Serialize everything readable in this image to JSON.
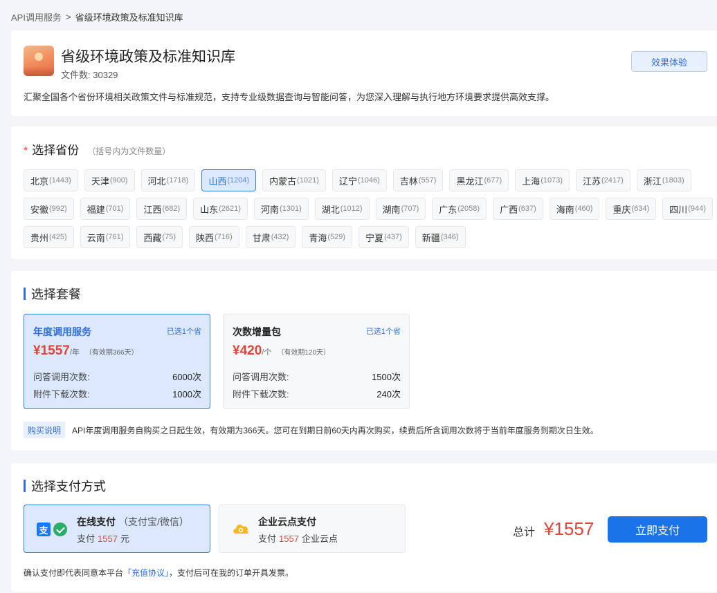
{
  "breadcrumb": {
    "parent": "API调用服务",
    "separator": ">",
    "current": "省级环境政策及标准知识库"
  },
  "header": {
    "title": "省级环境政策及标准知识库",
    "file_count_label": "文件数:",
    "file_count": "30329",
    "experience_button": "效果体验",
    "description": "汇聚全国各个省份环境相关政策文件与标准规范，支持专业级数据查询与智能问答，为您深入理解与执行地方环境要求提供高效支撑。"
  },
  "province": {
    "required_mark": "*",
    "title": "选择省份",
    "hint": "（括号内为文件数量）",
    "items": [
      {
        "name": "北京",
        "count": "(1443)"
      },
      {
        "name": "天津",
        "count": "(900)"
      },
      {
        "name": "河北",
        "count": "(1718)"
      },
      {
        "name": "山西",
        "count": "(1204)",
        "selected": true
      },
      {
        "name": "内蒙古",
        "count": "(1021)"
      },
      {
        "name": "辽宁",
        "count": "(1046)"
      },
      {
        "name": "吉林",
        "count": "(557)"
      },
      {
        "name": "黑龙江",
        "count": "(677)"
      },
      {
        "name": "上海",
        "count": "(1073)"
      },
      {
        "name": "江苏",
        "count": "(2417)"
      },
      {
        "name": "浙江",
        "count": "(1803)"
      },
      {
        "name": "安徽",
        "count": "(992)"
      },
      {
        "name": "福建",
        "count": "(701)"
      },
      {
        "name": "江西",
        "count": "(682)"
      },
      {
        "name": "山东",
        "count": "(2621)"
      },
      {
        "name": "河南",
        "count": "(1301)"
      },
      {
        "name": "湖北",
        "count": "(1012)"
      },
      {
        "name": "湖南",
        "count": "(707)"
      },
      {
        "name": "广东",
        "count": "(2058)"
      },
      {
        "name": "广西",
        "count": "(637)"
      },
      {
        "name": "海南",
        "count": "(460)"
      },
      {
        "name": "重庆",
        "count": "(634)"
      },
      {
        "name": "四川",
        "count": "(944)"
      },
      {
        "name": "贵州",
        "count": "(425)"
      },
      {
        "name": "云南",
        "count": "(761)"
      },
      {
        "name": "西藏",
        "count": "(75)"
      },
      {
        "name": "陕西",
        "count": "(716)"
      },
      {
        "name": "甘肃",
        "count": "(432)"
      },
      {
        "name": "青海",
        "count": "(529)"
      },
      {
        "name": "宁夏",
        "count": "(437)"
      },
      {
        "name": "新疆",
        "count": "(346)"
      }
    ]
  },
  "plan": {
    "title": "选择套餐",
    "annual": {
      "name": "年度调用服务",
      "selected_tag": "已选1个省",
      "price": "¥1557",
      "unit": "/年",
      "validity": "（有效期366天）",
      "qa_label": "问答调用次数:",
      "qa_value": "6000次",
      "dl_label": "附件下载次数:",
      "dl_value": "1000次"
    },
    "pack": {
      "name": "次数增量包",
      "selected_tag": "已选1个省",
      "price": "¥420",
      "unit": "/个",
      "validity": "（有效期120天）",
      "qa_label": "问答调用次数:",
      "qa_value": "1500次",
      "dl_label": "附件下载次数:",
      "dl_value": "240次"
    },
    "buy_tag": "购买说明",
    "buy_text": "API年度调用服务自购买之日起生效，有效期为366天。您可在到期日前60天内再次购买，续费后所含调用次数将于当前年度服务到期次日生效。"
  },
  "payment": {
    "title": "选择支付方式",
    "online": {
      "name": "在线支付",
      "sub": "（支付宝/微信）",
      "line_prefix": "支付",
      "amount": "1557",
      "line_suffix": "元",
      "alipay_glyph": "支"
    },
    "enterprise": {
      "name": "企业云点支付",
      "line_prefix": "支付",
      "amount": "1557",
      "line_suffix": "企业云点"
    },
    "total_label": "总计",
    "total_value": "¥1557",
    "pay_button": "立即支付",
    "agree_prefix": "确认支付即代表同意本平台",
    "agree_link": "「充值协议」",
    "agree_suffix": "，支付后可在我的订单开具发票。"
  },
  "colors": {
    "accent": "#1a73e8",
    "price": "#e0453a",
    "selected_bg": "#dbe8fd"
  }
}
